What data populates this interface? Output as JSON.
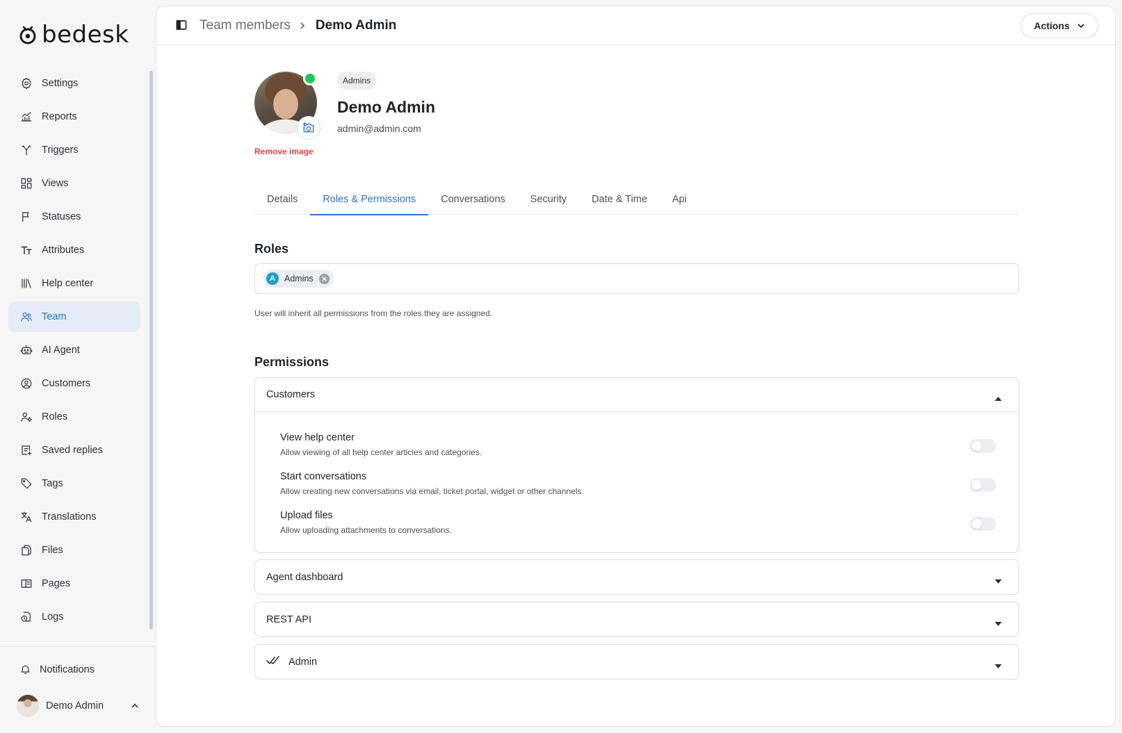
{
  "app": {
    "logo_text": "bedesk"
  },
  "sidebar": {
    "items": [
      {
        "label": "Settings",
        "icon": "gear-icon"
      },
      {
        "label": "Reports",
        "icon": "chart-icon"
      },
      {
        "label": "Triggers",
        "icon": "branch-icon"
      },
      {
        "label": "Views",
        "icon": "grid-icon"
      },
      {
        "label": "Statuses",
        "icon": "flag-icon"
      },
      {
        "label": "Attributes",
        "icon": "text-size-icon"
      },
      {
        "label": "Help center",
        "icon": "library-icon"
      },
      {
        "label": "Team",
        "icon": "users-icon",
        "active": true
      },
      {
        "label": "AI Agent",
        "icon": "robot-icon"
      },
      {
        "label": "Customers",
        "icon": "user-circle-icon"
      },
      {
        "label": "Roles",
        "icon": "user-gear-icon"
      },
      {
        "label": "Saved replies",
        "icon": "note-add-icon"
      },
      {
        "label": "Tags",
        "icon": "tag-icon"
      },
      {
        "label": "Translations",
        "icon": "translate-icon"
      },
      {
        "label": "Files",
        "icon": "files-icon"
      },
      {
        "label": "Pages",
        "icon": "layout-icon"
      },
      {
        "label": "Logs",
        "icon": "clock-file-icon"
      }
    ],
    "notifications_label": "Notifications",
    "user_name": "Demo Admin"
  },
  "header": {
    "breadcrumb_parent": "Team members",
    "breadcrumb_current": "Demo Admin",
    "actions_label": "Actions"
  },
  "profile": {
    "group_badge": "Admins",
    "name": "Demo Admin",
    "email": "admin@admin.com",
    "remove_image_label": "Remove image",
    "status_color": "#22c55e"
  },
  "tabs": [
    {
      "label": "Details"
    },
    {
      "label": "Roles & Permissions",
      "active": true
    },
    {
      "label": "Conversations"
    },
    {
      "label": "Security"
    },
    {
      "label": "Date & Time"
    },
    {
      "label": "Api"
    }
  ],
  "roles": {
    "title": "Roles",
    "chips": [
      {
        "letter": "A",
        "label": "Admins"
      }
    ],
    "hint": "User will inherit all permissions from the roles they are assigned."
  },
  "permissions": {
    "title": "Permissions",
    "groups": [
      {
        "label": "Customers",
        "expanded": true,
        "items": [
          {
            "name": "View help center",
            "description": "Allow viewing of all help center articles and categories.",
            "enabled": false
          },
          {
            "name": "Start conversations",
            "description": "Allow creating new conversations via email, ticket portal, widget or other channels.",
            "enabled": false
          },
          {
            "name": "Upload files",
            "description": "Allow uploading attachments to conversations.",
            "enabled": false
          }
        ]
      },
      {
        "label": "Agent dashboard",
        "expanded": false
      },
      {
        "label": "REST API",
        "expanded": false
      },
      {
        "label": "Admin",
        "expanded": false,
        "icon": "double-check-icon"
      }
    ]
  },
  "colors": {
    "accent": "#2f6fd6",
    "danger": "#e0433f",
    "online": "#22c55e"
  }
}
